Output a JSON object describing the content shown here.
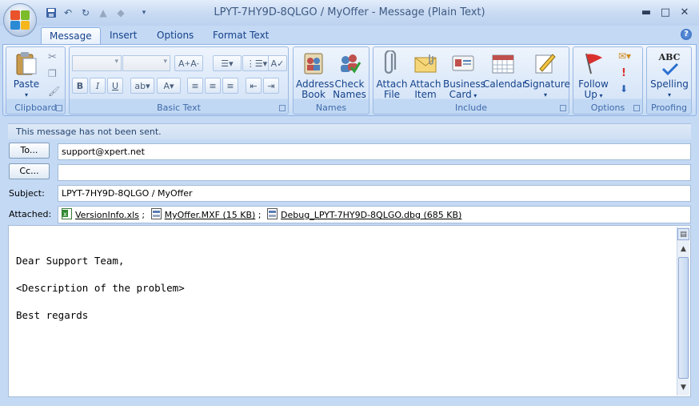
{
  "window": {
    "title": "LPYT-7HY9D-8QLGO / MyOffer - Message (Plain Text)"
  },
  "quick_access": [
    "save-icon",
    "undo-icon",
    "redo-icon",
    "up-arrow-icon",
    "down-arrow-icon",
    "customize-icon"
  ],
  "window_controls": {
    "minimize": "▬",
    "maximize": "□",
    "close": "✕"
  },
  "tabs": [
    {
      "label": "Message",
      "active": true
    },
    {
      "label": "Insert",
      "active": false
    },
    {
      "label": "Options",
      "active": false
    },
    {
      "label": "Format Text",
      "active": false
    }
  ],
  "ribbon": {
    "clipboard": {
      "label": "Clipboard",
      "paste": "Paste"
    },
    "basic_text": {
      "label": "Basic Text"
    },
    "names": {
      "label": "Names",
      "address_book_1": "Address",
      "address_book_2": "Book",
      "check_names_1": "Check",
      "check_names_2": "Names"
    },
    "include": {
      "label": "Include",
      "attach_file_1": "Attach",
      "attach_file_2": "File",
      "attach_item_1": "Attach",
      "attach_item_2": "Item",
      "business_card_1": "Business",
      "business_card_2": "Card",
      "calendar": "Calendar",
      "signature": "Signature"
    },
    "options": {
      "label": "Options",
      "follow_up_1": "Follow",
      "follow_up_2": "Up"
    },
    "proofing": {
      "label": "Proofing",
      "spelling": "Spelling",
      "abc": "ABC"
    }
  },
  "message": {
    "info_bar": "This message has not been sent.",
    "to_button": "To...",
    "cc_button": "Cc...",
    "to_value": "support@xpert.net",
    "cc_value": "",
    "subject_label": "Subject:",
    "subject_value": "LPYT-7HY9D-8QLGO / MyOffer",
    "attached_label": "Attached:",
    "attachments": [
      {
        "name": "VersionInfo.xls",
        "sep": ";"
      },
      {
        "name": "MyOffer.MXF (15 KB)",
        "sep": ";"
      },
      {
        "name": "Debug_LPYT-7HY9D-8QLGO.dbg (685 KB)",
        "sep": ""
      }
    ],
    "body_lines": [
      "Dear Support Team,",
      "<Description of the problem>",
      "Best regards"
    ]
  },
  "colors": {
    "accent": "#15428b",
    "ribbon_bg": "#dbe8f8",
    "window_bg": "#c4d9f4"
  }
}
